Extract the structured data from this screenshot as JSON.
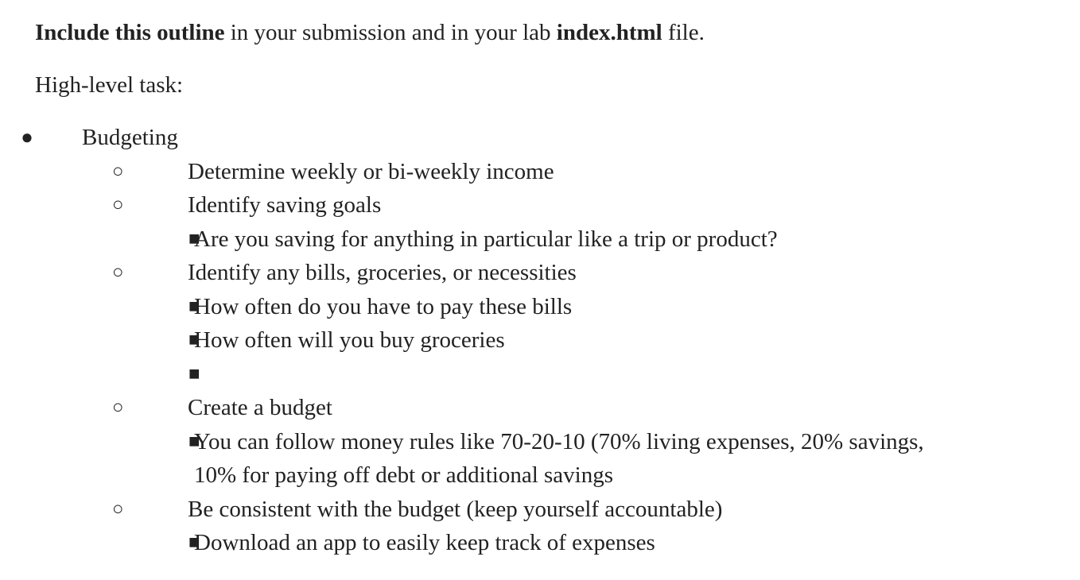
{
  "intro": {
    "bold1": "Include this outline",
    "text1": " in your submission and in your lab ",
    "bold2": "index.html",
    "text2": " file."
  },
  "task_label": "High-level task:",
  "outline": {
    "level1_bullet": "●",
    "level2_bullet": "○",
    "level3_bullet": "■",
    "top": "Budgeting",
    "items": [
      {
        "label": "Determine weekly or bi-weekly income"
      },
      {
        "label": "Identify saving goals",
        "sub": [
          "Are you saving for anything in particular like a trip or product?"
        ]
      },
      {
        "label": "Identify any bills, groceries, or necessities",
        "sub": [
          "How often do you have to pay these bills",
          "How often will you buy groceries",
          ""
        ]
      },
      {
        "label": "Create a budget",
        "sub": [
          "You can follow money rules like 70-20-10 (70% living expenses, 20% savings, 10% for paying off debt or additional savings"
        ]
      },
      {
        "label": "Be consistent with the budget (keep yourself accountable)",
        "sub": [
          "Download an app to easily keep track of expenses"
        ]
      }
    ]
  }
}
